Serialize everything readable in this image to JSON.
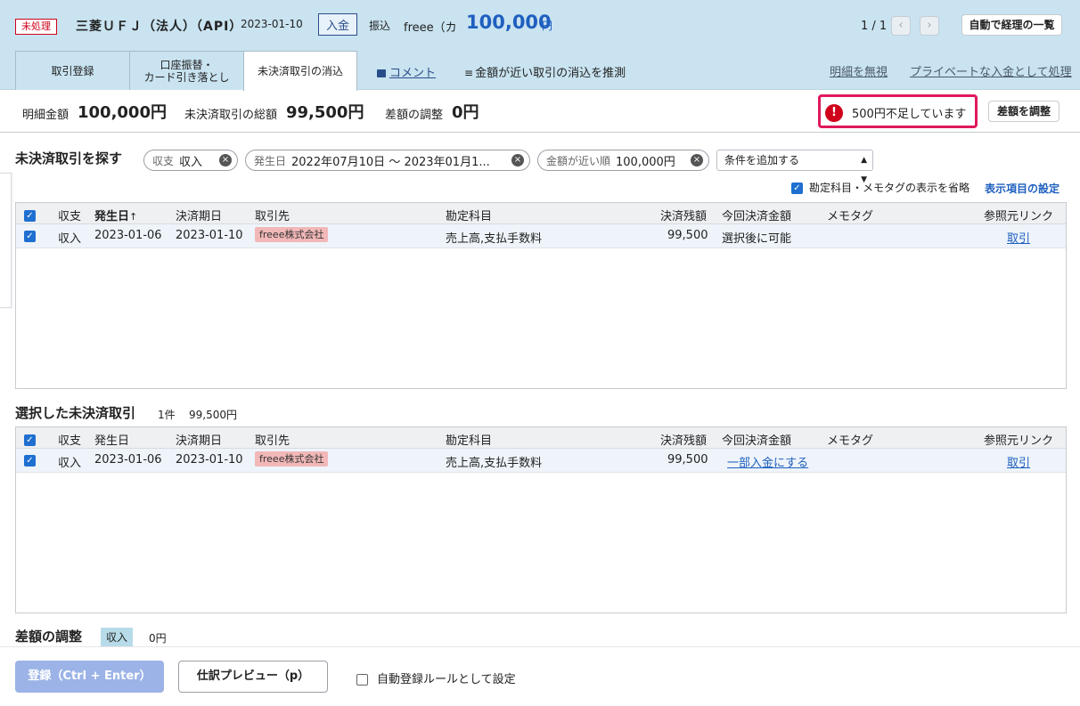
{
  "header": {
    "status_badge": "未処理",
    "bank_name": "三菱ＵＦＪ（法人）（API）",
    "date": "2023-01-10",
    "type": "入金",
    "transfer": "振込",
    "partner": "freee（カ",
    "amount": "100,000",
    "amount_unit": "円",
    "pager": "1 / 1",
    "prev": "‹",
    "next": "›",
    "list_button": "自動で経理の一覧"
  },
  "tabs": [
    {
      "label": "取引登録"
    },
    {
      "label": "口座振替・\nカード引き落とし"
    },
    {
      "label": "未決済取引の消込"
    }
  ],
  "tab_links": {
    "comment": "コメント",
    "guess": "金額が近い取引の消込を推測",
    "ignore": "明細を無視",
    "private": "プライベートな入金として処理"
  },
  "summary": {
    "detail_amount_label": "明細金額",
    "detail_amount": "100,000円",
    "unsettled_total_label": "未決済取引の総額",
    "unsettled_total": "99,500円",
    "adjust_label": "差額の調整",
    "adjust_value": "0円",
    "warning_icon": "!",
    "warning": "500円不足しています",
    "adjust_button": "差額を調整"
  },
  "search": {
    "title": "未決済取引を探す",
    "chips": [
      {
        "key": "収支",
        "value": "収入"
      },
      {
        "key": "発生日",
        "value": "2022年07月10日 〜 2023年01月1..."
      },
      {
        "key": "金額が近い順",
        "value": "100,000円"
      }
    ],
    "add_condition": "条件を追加する",
    "omit_label": "勘定科目・メモタグの表示を省略",
    "settings_link": "表示項目の設定"
  },
  "table_headers": {
    "type": "収支",
    "date": "発生日",
    "sort_icon": "↑",
    "due": "決済期日",
    "partner": "取引先",
    "account": "勘定科目",
    "balance": "決済残額",
    "this_amount": "今回決済金額",
    "memo": "メモタグ",
    "ref": "参照元リンク"
  },
  "search_rows": [
    {
      "type": "収入",
      "date": "2023-01-06",
      "due": "2023-01-10",
      "partner": "freee株式会社",
      "account": "売上高,支払手数料",
      "balance": "99,500",
      "this_amount": "選択後に可能",
      "memo": "",
      "ref": "取引"
    }
  ],
  "selected": {
    "title": "選択した未決済取引",
    "count": "1件",
    "total": "99,500円",
    "rows": [
      {
        "type": "収入",
        "date": "2023-01-06",
        "due": "2023-01-10",
        "partner": "freee株式会社",
        "account": "売上高,支払手数料",
        "balance": "99,500",
        "this_amount": "一部入金にする",
        "memo": "",
        "ref": "取引"
      }
    ]
  },
  "adjustment": {
    "title": "差額の調整",
    "type": "収入",
    "value": "0円"
  },
  "footer": {
    "register": "登録（Ctrl + Enter）",
    "preview": "仕訳プレビュー（p）",
    "rule_option": "自動登録ルールとして設定"
  }
}
